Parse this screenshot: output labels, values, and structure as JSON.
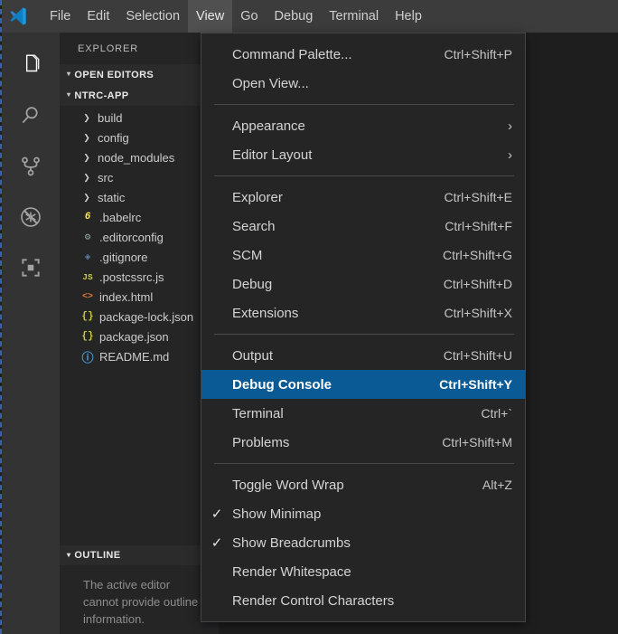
{
  "window": {
    "logo_icon": "vscode-logo-icon",
    "menubar": [
      {
        "label": "File",
        "active": false
      },
      {
        "label": "Edit",
        "active": false
      },
      {
        "label": "Selection",
        "active": false
      },
      {
        "label": "View",
        "active": true
      },
      {
        "label": "Go",
        "active": false
      },
      {
        "label": "Debug",
        "active": false
      },
      {
        "label": "Terminal",
        "active": false
      },
      {
        "label": "Help",
        "active": false
      }
    ]
  },
  "activitybar": {
    "items": [
      {
        "name": "explorer",
        "icon": "files-icon",
        "selected": true
      },
      {
        "name": "search",
        "icon": "search-icon",
        "selected": false
      },
      {
        "name": "source-control",
        "icon": "source-control-branch-icon",
        "selected": false
      },
      {
        "name": "debug",
        "icon": "debug-bug-icon",
        "selected": false
      },
      {
        "name": "extensions",
        "icon": "extensions-squares-icon",
        "selected": false
      }
    ]
  },
  "sidebar": {
    "title": "EXPLORER",
    "sections": [
      {
        "label": "OPEN EDITORS",
        "twisty": "▾"
      },
      {
        "label": "NTRC-APP",
        "twisty": "▾"
      }
    ],
    "tree": [
      {
        "label": "build",
        "kind": "folder",
        "chevron": "❯",
        "icon": "",
        "icon_color": ""
      },
      {
        "label": "config",
        "kind": "folder",
        "chevron": "❯",
        "icon": "",
        "icon_color": ""
      },
      {
        "label": "node_modules",
        "kind": "folder",
        "chevron": "❯",
        "icon": "",
        "icon_color": ""
      },
      {
        "label": "src",
        "kind": "folder",
        "chevron": "❯",
        "icon": "",
        "icon_color": ""
      },
      {
        "label": "static",
        "kind": "folder",
        "chevron": "❯",
        "icon": "",
        "icon_color": ""
      },
      {
        "label": ".babelrc",
        "kind": "file",
        "chevron": "",
        "icon": "6",
        "icon_color": "#f9e64f",
        "icon_name": "babel-icon"
      },
      {
        "label": ".editorconfig",
        "kind": "file",
        "chevron": "",
        "icon": "⚙",
        "icon_color": "#8aa6a6",
        "icon_name": "gear-icon"
      },
      {
        "label": ".gitignore",
        "kind": "file",
        "chevron": "",
        "icon": "◈",
        "icon_color": "#5d7a99",
        "icon_name": "git-icon"
      },
      {
        "label": ".postcssrc.js",
        "kind": "file",
        "chevron": "",
        "icon": "JS",
        "icon_color": "#cbcb41",
        "icon_name": "javascript-icon"
      },
      {
        "label": "index.html",
        "kind": "file",
        "chevron": "",
        "icon": "<>",
        "icon_color": "#e37933",
        "icon_name": "html-icon"
      },
      {
        "label": "package-lock.json",
        "kind": "file",
        "chevron": "",
        "icon": "{}",
        "icon_color": "#cbcb41",
        "icon_name": "json-icon"
      },
      {
        "label": "package.json",
        "kind": "file",
        "chevron": "",
        "icon": "{}",
        "icon_color": "#cbcb41",
        "icon_name": "json-icon"
      },
      {
        "label": "README.md",
        "kind": "file",
        "chevron": "",
        "icon": "ⓘ",
        "icon_color": "#4a9fd8",
        "icon_name": "info-markdown-icon"
      }
    ],
    "outline": {
      "label": "OUTLINE",
      "twisty": "▾",
      "message": "The active editor cannot provide outline information."
    }
  },
  "view_menu": {
    "items": [
      {
        "type": "item",
        "label": "Command Palette...",
        "shortcut": "Ctrl+Shift+P",
        "checked": false,
        "submenu": false,
        "selected": false
      },
      {
        "type": "item",
        "label": "Open View...",
        "shortcut": "",
        "checked": false,
        "submenu": false,
        "selected": false
      },
      {
        "type": "separator"
      },
      {
        "type": "item",
        "label": "Appearance",
        "shortcut": "",
        "checked": false,
        "submenu": true,
        "selected": false
      },
      {
        "type": "item",
        "label": "Editor Layout",
        "shortcut": "",
        "checked": false,
        "submenu": true,
        "selected": false
      },
      {
        "type": "separator"
      },
      {
        "type": "item",
        "label": "Explorer",
        "shortcut": "Ctrl+Shift+E",
        "checked": false,
        "submenu": false,
        "selected": false
      },
      {
        "type": "item",
        "label": "Search",
        "shortcut": "Ctrl+Shift+F",
        "checked": false,
        "submenu": false,
        "selected": false
      },
      {
        "type": "item",
        "label": "SCM",
        "shortcut": "Ctrl+Shift+G",
        "checked": false,
        "submenu": false,
        "selected": false
      },
      {
        "type": "item",
        "label": "Debug",
        "shortcut": "Ctrl+Shift+D",
        "checked": false,
        "submenu": false,
        "selected": false
      },
      {
        "type": "item",
        "label": "Extensions",
        "shortcut": "Ctrl+Shift+X",
        "checked": false,
        "submenu": false,
        "selected": false
      },
      {
        "type": "separator"
      },
      {
        "type": "item",
        "label": "Output",
        "shortcut": "Ctrl+Shift+U",
        "checked": false,
        "submenu": false,
        "selected": false
      },
      {
        "type": "item",
        "label": "Debug Console",
        "shortcut": "Ctrl+Shift+Y",
        "checked": false,
        "submenu": false,
        "selected": true
      },
      {
        "type": "item",
        "label": "Terminal",
        "shortcut": "Ctrl+`",
        "checked": false,
        "submenu": false,
        "selected": false
      },
      {
        "type": "item",
        "label": "Problems",
        "shortcut": "Ctrl+Shift+M",
        "checked": false,
        "submenu": false,
        "selected": false
      },
      {
        "type": "separator"
      },
      {
        "type": "item",
        "label": "Toggle Word Wrap",
        "shortcut": "Alt+Z",
        "checked": false,
        "submenu": false,
        "selected": false
      },
      {
        "type": "item",
        "label": "Show Minimap",
        "shortcut": "",
        "checked": true,
        "submenu": false,
        "selected": false
      },
      {
        "type": "item",
        "label": "Show Breadcrumbs",
        "shortcut": "",
        "checked": true,
        "submenu": false,
        "selected": false
      },
      {
        "type": "item",
        "label": "Render Whitespace",
        "shortcut": "",
        "checked": false,
        "submenu": false,
        "selected": false
      },
      {
        "type": "item",
        "label": "Render Control Characters",
        "shortcut": "",
        "checked": false,
        "submenu": false,
        "selected": false
      }
    ],
    "checkmark_glyph": "✓",
    "submenu_glyph": "›"
  },
  "colors": {
    "titlebar_bg": "#3c3c3c",
    "activitybar_bg": "#333333",
    "sidebar_bg": "#252526",
    "editor_bg": "#1e1e1e",
    "menu_bg": "#252526",
    "menu_selected_bg": "#0a5a96",
    "menu_border": "#454545",
    "focus_border": "#3b5fa8"
  }
}
